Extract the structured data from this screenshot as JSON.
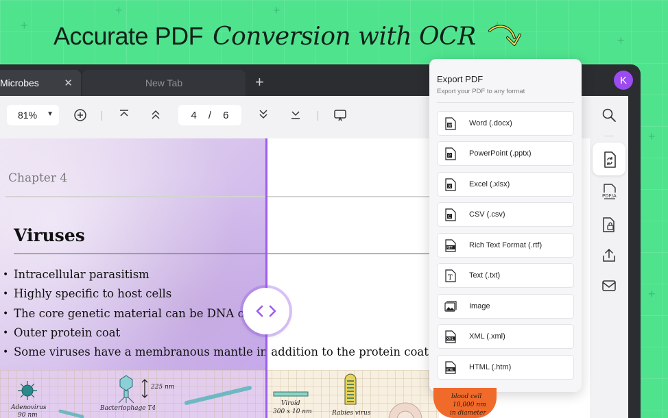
{
  "headline": {
    "part1": "Accurate PDF",
    "part2": "Conversion with OCR"
  },
  "tabs": [
    {
      "label": "Microbes",
      "active": true
    },
    {
      "label": "New Tab",
      "active": false
    }
  ],
  "avatar": {
    "initial": "K",
    "color": "#9a4cf0"
  },
  "toolbar": {
    "zoom": "81%",
    "current_page": "4",
    "page_separator": "/",
    "total_pages": "6"
  },
  "document": {
    "chapter": "Chapter 4",
    "title": "Viruses",
    "bullets": [
      "Intracellular parasitism",
      "Highly specific to host cells",
      "The core genetic material can be DNA or R",
      "Outer protein coat",
      "Some viruses have a membranous mantle in addition to the protein coat"
    ],
    "sketch_labels": {
      "adenovirus": "Adenovirus",
      "adeno_size": "90 nm",
      "bacteriophage": "Bacteriophage T4",
      "bacteriophage_size": "225 nm",
      "viroid": "Viroid",
      "viroid_size": "300 x 10 nm",
      "rabies": "Rabies virus",
      "blood": "blood cell",
      "blood_size": "10,000 nm",
      "blood_note": "in diameter"
    }
  },
  "export_panel": {
    "title": "Export PDF",
    "subtitle": "Export your PDF to any format",
    "options": [
      {
        "label": "Word (.docx)",
        "icon": "word-icon",
        "badge": "W"
      },
      {
        "label": "PowerPoint (.pptx)",
        "icon": "powerpoint-icon",
        "badge": "P"
      },
      {
        "label": "Excel (.xlsx)",
        "icon": "excel-icon",
        "badge": "X"
      },
      {
        "label": "CSV (.csv)",
        "icon": "csv-icon",
        "badge": "C"
      },
      {
        "label": "Rich Text Format (.rtf)",
        "icon": "rtf-icon",
        "badge": "RTF"
      },
      {
        "label": "Text (.txt)",
        "icon": "text-icon",
        "badge": "T"
      },
      {
        "label": "Image",
        "icon": "image-icon",
        "badge": ""
      },
      {
        "label": "XML (.xml)",
        "icon": "xml-icon",
        "badge": "XML"
      },
      {
        "label": "HTML (.htm)",
        "icon": "html-icon",
        "badge": "HTML"
      }
    ]
  },
  "sidebar": {
    "pdfa_label": "PDF/A"
  },
  "colors": {
    "accent": "#9b5cf0",
    "background": "#4fe38e",
    "window": "#2b2d31"
  }
}
